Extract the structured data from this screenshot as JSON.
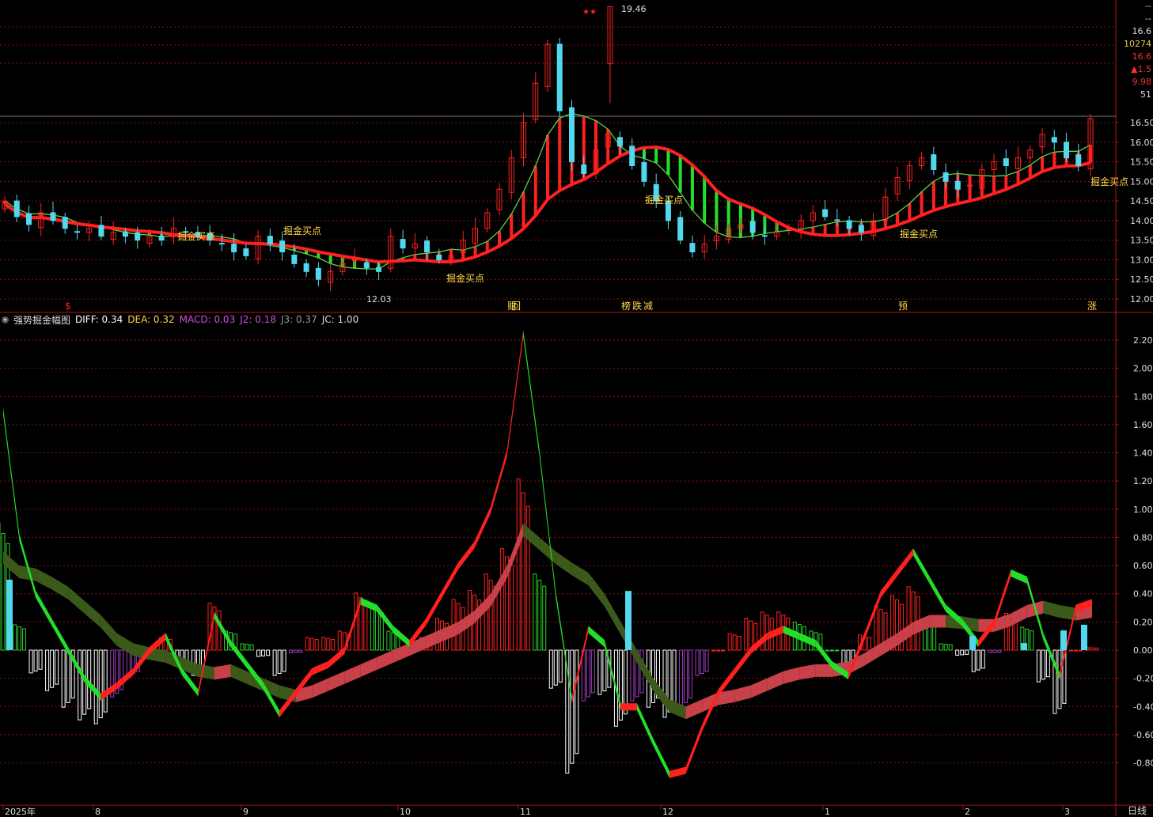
{
  "quote_panel": {
    "line1": "--",
    "line2": "--",
    "line3": "16.6",
    "line4": "10274",
    "line5": "16.6",
    "line6": "▲1.5",
    "line7": "9.98",
    "line8": "51"
  },
  "indicator_legend": {
    "name": "强势掘金幅图",
    "diff_label": "DIFF: 0.34",
    "dea_label": "DEA: 0.32",
    "macd_label": "MACD: 0.03",
    "j2_label": "J2: 0.18",
    "j3_label": "J3: 0.37",
    "jc_label": "JC: 1.00"
  },
  "period_label": "日线",
  "colors": {
    "up": "#ff2020",
    "down": "#52d8ee",
    "green_fill": "#22e02a",
    "dark_band": "#3b5a1a",
    "pink_band": "#c84048",
    "macd_neg": "#a040c0",
    "label_yellow": "#ffd84a",
    "grid": "#8a1010"
  },
  "chart_data": [
    {
      "type": "candlestick",
      "y_ticks": [
        "16.50",
        "16.00",
        "15.50",
        "15.00",
        "14.50",
        "14.00",
        "13.50",
        "13.00",
        "12.50",
        "12.00"
      ],
      "ylim": [
        11.8,
        19.9
      ],
      "high_marker": "19.46",
      "low_marker": "12.03",
      "signal_label": "掘金买点",
      "event_tags": [
        "$",
        "财",
        "榜",
        "跌",
        "减",
        "预",
        "涨"
      ],
      "close_path": [
        14.5,
        14.1,
        13.9,
        14.2,
        14.0,
        13.8,
        13.7,
        13.8,
        13.6,
        13.7,
        13.6,
        13.5,
        13.6,
        13.5,
        13.8,
        13.7,
        13.6,
        13.5,
        13.4,
        13.2,
        13.1,
        13.6,
        13.4,
        13.2,
        12.9,
        12.7,
        12.5,
        12.7,
        12.9,
        13.0,
        12.8,
        12.7,
        13.6,
        13.3,
        13.4,
        13.2,
        13.0,
        13.1,
        13.5,
        13.8,
        14.2,
        14.8,
        15.6,
        16.5,
        17.5,
        18.5,
        16.8,
        15.5,
        15.2,
        15.8,
        16.2,
        15.9,
        15.4,
        15.0,
        14.5,
        14.0,
        13.5,
        13.2,
        13.4,
        13.6,
        13.8,
        13.9,
        13.7,
        13.6,
        13.7,
        13.8,
        14.0,
        14.2,
        14.1,
        14.0,
        13.8,
        13.7,
        14.0,
        14.6,
        15.1,
        15.4,
        15.6,
        15.3,
        15.0,
        14.8,
        14.9,
        15.3,
        15.5,
        15.4,
        15.6,
        15.8,
        16.2,
        16.0,
        15.6,
        15.4,
        16.6
      ]
    },
    {
      "type": "macd",
      "y_ticks": [
        "2.20",
        "2.00",
        "1.80",
        "1.60",
        "1.40",
        "1.20",
        "1.00",
        "0.80",
        "0.60",
        "0.40",
        "0.20",
        "0.00",
        "-0.20",
        "-0.40",
        "-0.60",
        "-0.80"
      ],
      "ylim": [
        -1.0,
        2.3
      ],
      "x_labels": [
        "2025年",
        "8",
        "9",
        "10",
        "11",
        "12",
        "1",
        "2",
        "3"
      ],
      "diff": [
        1.7,
        0.8,
        0.4,
        0.2,
        0.0,
        -0.2,
        -0.33,
        -0.25,
        -0.15,
        0.0,
        0.1,
        -0.15,
        -0.3,
        0.25,
        0.05,
        -0.1,
        -0.25,
        -0.45,
        -0.3,
        -0.15,
        -0.1,
        0.0,
        0.35,
        0.3,
        0.15,
        0.05,
        0.2,
        0.4,
        0.6,
        0.75,
        1.0,
        1.4,
        2.25,
        1.4,
        0.4,
        -0.35,
        0.15,
        0.05,
        -0.4,
        -0.4,
        -0.65,
        -0.88,
        -0.85,
        -0.55,
        -0.3,
        -0.15,
        0.0,
        0.1,
        0.15,
        0.1,
        0.05,
        -0.1,
        -0.18,
        0.1,
        0.4,
        0.55,
        0.7,
        0.5,
        0.3,
        0.2,
        0.05,
        0.2,
        0.55,
        0.5,
        0.1,
        -0.18,
        0.3,
        0.34
      ],
      "dea": [
        0.7,
        0.6,
        0.58,
        0.52,
        0.45,
        0.35,
        0.25,
        0.12,
        0.05,
        0.02,
        0.0,
        -0.05,
        -0.1,
        -0.12,
        -0.1,
        -0.15,
        -0.2,
        -0.25,
        -0.28,
        -0.25,
        -0.2,
        -0.15,
        -0.1,
        -0.05,
        0.0,
        0.05,
        0.1,
        0.15,
        0.2,
        0.28,
        0.4,
        0.6,
        0.9,
        0.8,
        0.7,
        0.62,
        0.55,
        0.4,
        0.2,
        0.0,
        -0.2,
        -0.35,
        -0.4,
        -0.35,
        -0.3,
        -0.28,
        -0.25,
        -0.2,
        -0.15,
        -0.12,
        -0.1,
        -0.1,
        -0.08,
        -0.02,
        0.05,
        0.12,
        0.2,
        0.25,
        0.25,
        0.24,
        0.22,
        0.22,
        0.26,
        0.32,
        0.35,
        0.32,
        0.3,
        0.32
      ]
    }
  ]
}
